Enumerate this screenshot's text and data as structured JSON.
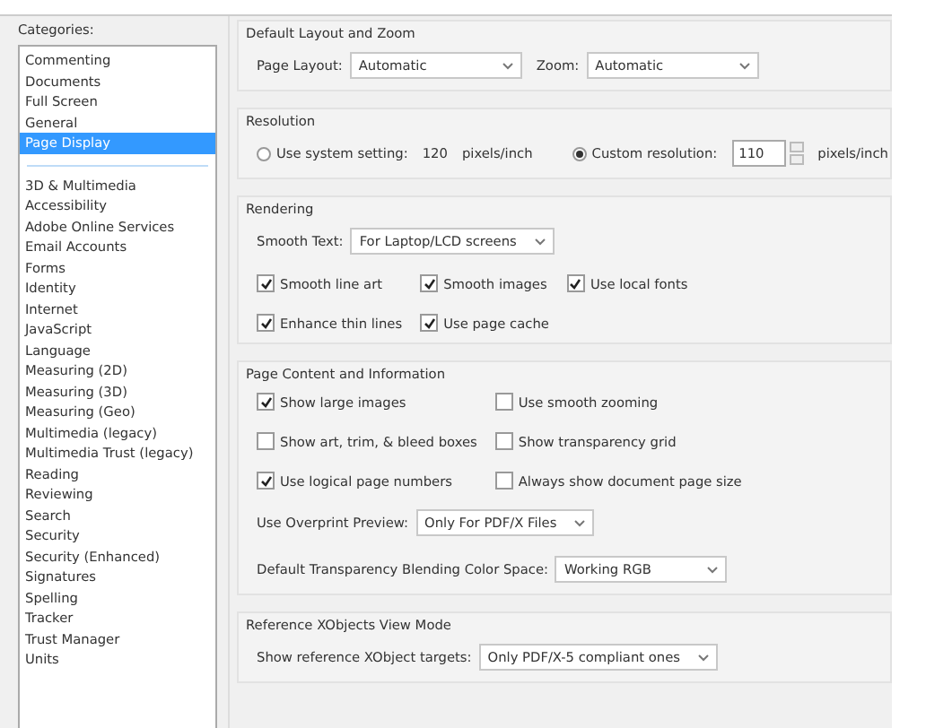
{
  "categories": {
    "label": "Categories:",
    "pinned_items": [
      {
        "label": "Commenting",
        "selected": false
      },
      {
        "label": "Documents",
        "selected": false
      },
      {
        "label": "Full Screen",
        "selected": false
      },
      {
        "label": "General",
        "selected": false
      },
      {
        "label": "Page Display",
        "selected": true
      }
    ],
    "items": [
      {
        "label": "3D & Multimedia",
        "selected": false
      },
      {
        "label": "Accessibility",
        "selected": false
      },
      {
        "label": "Adobe Online Services",
        "selected": false
      },
      {
        "label": "Email Accounts",
        "selected": false
      },
      {
        "label": "Forms",
        "selected": false
      },
      {
        "label": "Identity",
        "selected": false
      },
      {
        "label": "Internet",
        "selected": false
      },
      {
        "label": "JavaScript",
        "selected": false
      },
      {
        "label": "Language",
        "selected": false
      },
      {
        "label": "Measuring (2D)",
        "selected": false
      },
      {
        "label": "Measuring (3D)",
        "selected": false
      },
      {
        "label": "Measuring (Geo)",
        "selected": false
      },
      {
        "label": "Multimedia (legacy)",
        "selected": false
      },
      {
        "label": "Multimedia Trust (legacy)",
        "selected": false
      },
      {
        "label": "Reading",
        "selected": false
      },
      {
        "label": "Reviewing",
        "selected": false
      },
      {
        "label": "Search",
        "selected": false
      },
      {
        "label": "Security",
        "selected": false
      },
      {
        "label": "Security (Enhanced)",
        "selected": false
      },
      {
        "label": "Signatures",
        "selected": false
      },
      {
        "label": "Spelling",
        "selected": false
      },
      {
        "label": "Tracker",
        "selected": false
      },
      {
        "label": "Trust Manager",
        "selected": false
      },
      {
        "label": "Units",
        "selected": false
      }
    ]
  },
  "sections": [
    {
      "title": "Default Layout and Zoom",
      "rows": [
        [
          {
            "kind": "dropdown",
            "label": "Page Layout:",
            "value": "Automatic"
          },
          {
            "kind": "dropdown",
            "label": "Zoom:",
            "value": "Automatic"
          }
        ]
      ]
    },
    {
      "title": "Resolution",
      "rows": [
        [
          {
            "kind": "radio",
            "label": "Use system setting:",
            "selected": false
          },
          {
            "kind": "text",
            "text": "120"
          },
          {
            "kind": "text",
            "text": "pixels/inch"
          },
          {
            "kind": "radio",
            "label": "Custom resolution:",
            "selected": true
          },
          {
            "kind": "spin",
            "value": "110"
          },
          {
            "kind": "text",
            "text": "pixels/inch"
          }
        ]
      ]
    },
    {
      "title": "Rendering",
      "rows": [
        [
          {
            "kind": "dropdown",
            "label": "Smooth Text:",
            "value": "For Laptop/LCD screens"
          }
        ],
        [
          {
            "kind": "checkbox",
            "label": "Smooth line art",
            "checked": true
          },
          {
            "kind": "checkbox",
            "label": "Smooth images",
            "checked": true
          },
          {
            "kind": "checkbox",
            "label": "Use local fonts",
            "checked": true
          }
        ],
        [
          {
            "kind": "checkbox",
            "label": "Enhance thin lines",
            "checked": true
          },
          {
            "kind": "checkbox",
            "label": "Use page cache",
            "checked": true
          }
        ]
      ]
    },
    {
      "title": "Page Content and Information",
      "rows": [
        [
          {
            "kind": "checkbox",
            "label": "Show large images",
            "checked": true
          },
          {
            "kind": "checkbox",
            "label": "Use smooth zooming",
            "checked": false
          }
        ],
        [
          {
            "kind": "checkbox",
            "label": "Show art, trim, & bleed boxes",
            "checked": false
          },
          {
            "kind": "checkbox",
            "label": "Show transparency grid",
            "checked": false
          }
        ],
        [
          {
            "kind": "checkbox",
            "label": "Use logical page numbers",
            "checked": true
          },
          {
            "kind": "checkbox",
            "label": "Always show document page size",
            "checked": false
          }
        ],
        [
          {
            "kind": "dropdown",
            "label": "Use Overprint Preview:",
            "value": "Only For PDF/X Files"
          }
        ],
        [
          {
            "kind": "dropdown",
            "label": "Default Transparency Blending Color Space:",
            "value": "Working RGB"
          }
        ]
      ]
    },
    {
      "title": "Reference XObjects View Mode",
      "rows": [
        [
          {
            "kind": "dropdown",
            "label": "Show reference XObject targets:",
            "value": "Only PDF/X-5 compliant ones"
          }
        ]
      ]
    }
  ]
}
